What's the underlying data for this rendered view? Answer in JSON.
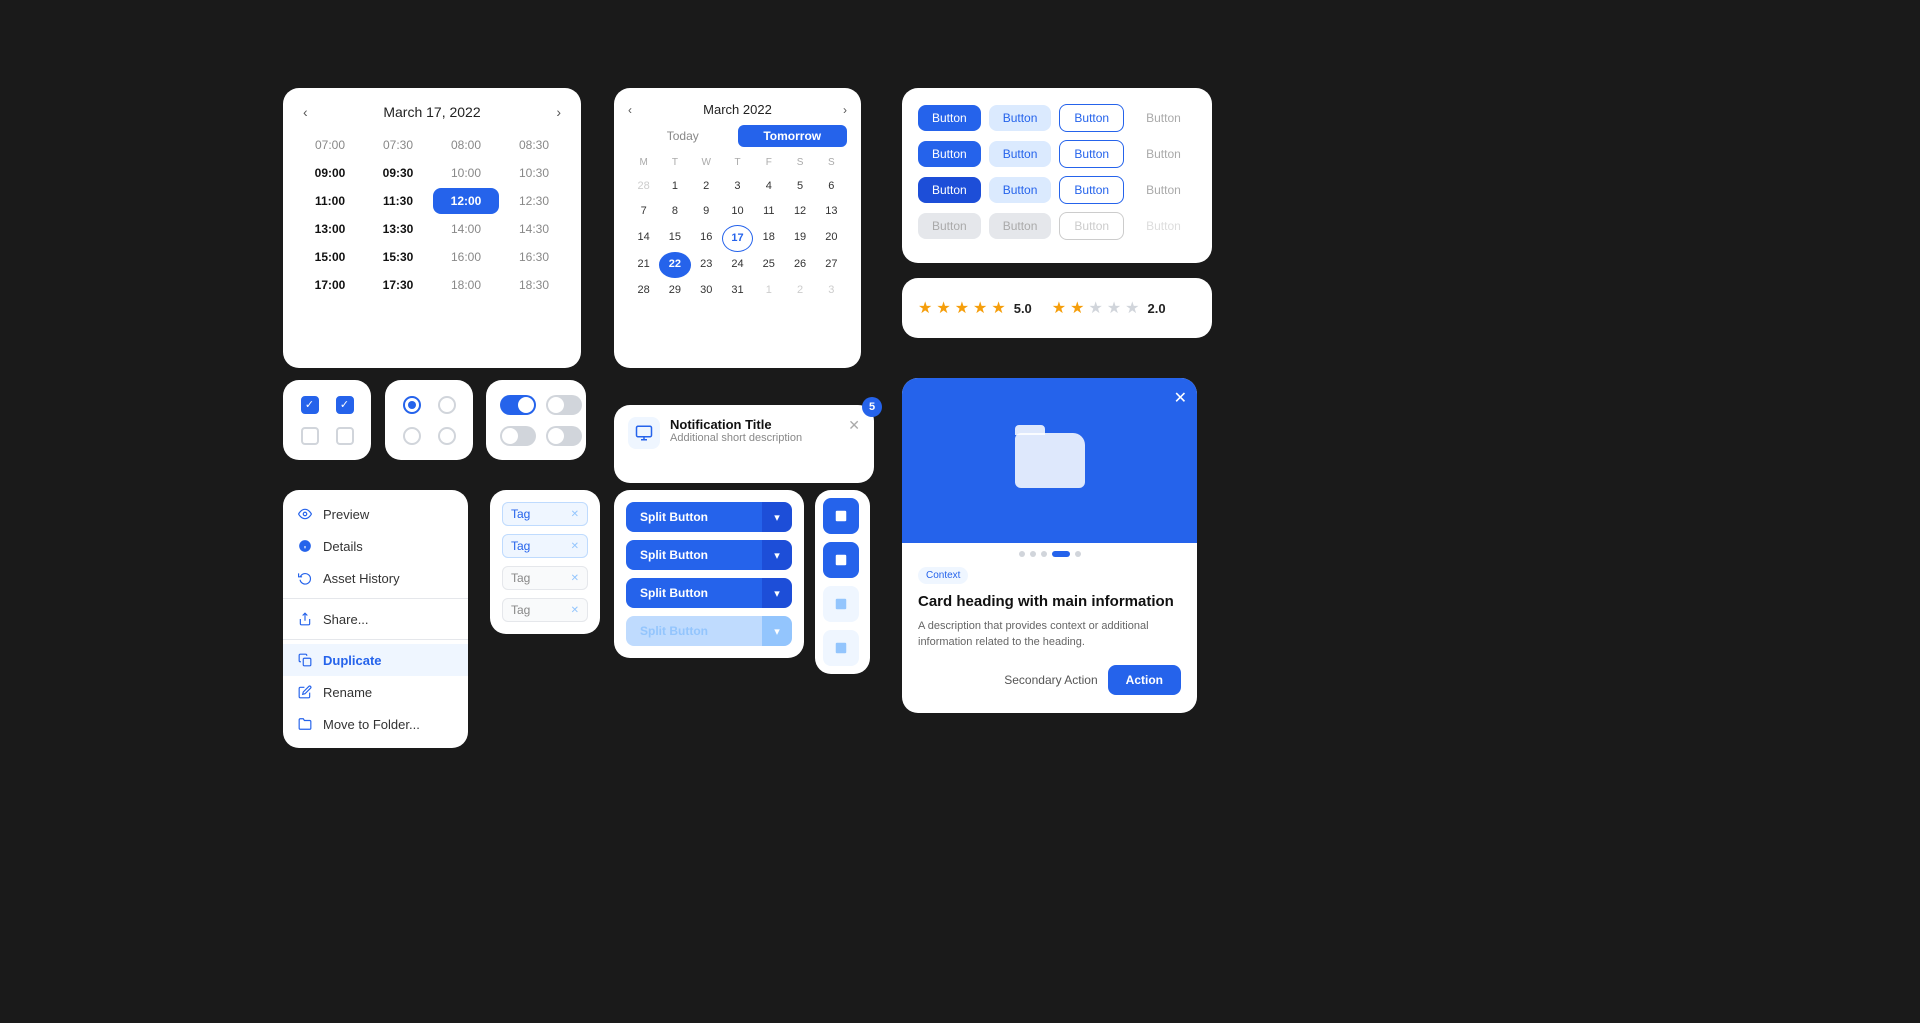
{
  "background": "#1a1a1a",
  "timePicker": {
    "title": "March 17, 2022",
    "rows": [
      [
        "07:00",
        "07:30",
        "08:00",
        "08:30"
      ],
      [
        "09:00",
        "09:30",
        "10:00",
        "10:30"
      ],
      [
        "11:00",
        "11:30",
        "12:00",
        "12:30"
      ],
      [
        "13:00",
        "13:30",
        "14:00",
        "14:30"
      ],
      [
        "15:00",
        "15:30",
        "16:00",
        "16:30"
      ],
      [
        "17:00",
        "17:30",
        "18:00",
        "18:30"
      ]
    ],
    "bold": [
      "09:00",
      "09:30",
      "11:00",
      "11:30",
      "13:00",
      "13:30",
      "15:00",
      "15:30",
      "17:00",
      "17:30"
    ],
    "selected": "12:00"
  },
  "calendar": {
    "title": "March 2022",
    "tabs": [
      "Today",
      "Tomorrow"
    ],
    "activeTab": "Tomorrow",
    "daysOfWeek": [
      "M",
      "T",
      "W",
      "T",
      "F",
      "S",
      "S"
    ],
    "weeks": [
      [
        {
          "n": "28",
          "other": true
        },
        {
          "n": "1"
        },
        {
          "n": "2"
        },
        {
          "n": "3"
        },
        {
          "n": "4"
        },
        {
          "n": "5"
        },
        {
          "n": "6"
        }
      ],
      [
        {
          "n": "7"
        },
        {
          "n": "8"
        },
        {
          "n": "9"
        },
        {
          "n": "10"
        },
        {
          "n": "11"
        },
        {
          "n": "12"
        },
        {
          "n": "13"
        }
      ],
      [
        {
          "n": "14"
        },
        {
          "n": "15"
        },
        {
          "n": "16"
        },
        {
          "n": "17",
          "today": true
        },
        {
          "n": "18"
        },
        {
          "n": "19"
        },
        {
          "n": "20"
        }
      ],
      [
        {
          "n": "21"
        },
        {
          "n": "22",
          "selected": true
        },
        {
          "n": "23"
        },
        {
          "n": "24"
        },
        {
          "n": "25"
        },
        {
          "n": "26"
        },
        {
          "n": "27"
        }
      ],
      [
        {
          "n": "28"
        },
        {
          "n": "29"
        },
        {
          "n": "30"
        },
        {
          "n": "31"
        },
        {
          "n": "1",
          "other": true
        },
        {
          "n": "2",
          "other": true
        },
        {
          "n": "3",
          "other": true
        }
      ]
    ]
  },
  "buttonsGrid": {
    "rows": [
      [
        {
          "label": "Button",
          "type": "primary"
        },
        {
          "label": "Button",
          "type": "primary-light"
        },
        {
          "label": "Button",
          "type": "outline"
        },
        {
          "label": "Button",
          "type": "ghost"
        }
      ],
      [
        {
          "label": "Button",
          "type": "primary"
        },
        {
          "label": "Button",
          "type": "primary-light"
        },
        {
          "label": "Button",
          "type": "outline"
        },
        {
          "label": "Button",
          "type": "ghost"
        }
      ],
      [
        {
          "label": "Button",
          "type": "primary-dark"
        },
        {
          "label": "Button",
          "type": "primary-light"
        },
        {
          "label": "Button",
          "type": "outline"
        },
        {
          "label": "Button",
          "type": "ghost"
        }
      ],
      [
        {
          "label": "Button",
          "type": "disabled"
        },
        {
          "label": "Button",
          "type": "disabled"
        },
        {
          "label": "Button",
          "type": "outline-disabled"
        },
        {
          "label": "Button",
          "type": "ghost-disabled"
        }
      ]
    ]
  },
  "stars": {
    "group1": {
      "value": 5.0,
      "filled": 5,
      "empty": 0
    },
    "group2": {
      "value": 2.0,
      "filled": 2,
      "empty": 3
    }
  },
  "card": {
    "tag": "Context",
    "heading": "Card heading with main information",
    "description": "A description that provides context or additional information related to the heading.",
    "secondaryAction": "Secondary Action",
    "primaryAction": "Action",
    "dots": 5,
    "activeDot": 3
  },
  "checkboxes": [
    {
      "checked": true
    },
    {
      "checked": true
    },
    {
      "checked": false
    },
    {
      "checked": false
    }
  ],
  "radios": [
    {
      "checked": true
    },
    {
      "checked": false
    },
    {
      "checked": false
    },
    {
      "checked": false
    }
  ],
  "toggles": [
    {
      "on": true
    },
    {
      "on": false
    },
    {
      "on": false
    },
    {
      "on": false
    }
  ],
  "contextMenu": {
    "items": [
      {
        "label": "Preview",
        "icon": "👁",
        "active": false
      },
      {
        "label": "Details",
        "icon": "ℹ️",
        "active": false
      },
      {
        "label": "Asset History",
        "icon": "🔄",
        "active": false
      },
      {
        "divider": true
      },
      {
        "label": "Share...",
        "icon": "📤",
        "active": false
      },
      {
        "divider": true
      },
      {
        "label": "Duplicate",
        "icon": "📋",
        "active": true
      },
      {
        "label": "Rename",
        "icon": "✏️",
        "active": false
      },
      {
        "label": "Move to Folder...",
        "icon": "📁",
        "active": false
      }
    ]
  },
  "tags": [
    {
      "label": "Tag",
      "ghost": false
    },
    {
      "label": "Tag",
      "ghost": false
    },
    {
      "label": "Tag",
      "ghost": true
    },
    {
      "label": "Tag",
      "ghost": true
    }
  ],
  "splitButtons": [
    {
      "label": "Split Button",
      "active": true
    },
    {
      "label": "Split Button",
      "active": true
    },
    {
      "label": "Split Button",
      "active": true
    },
    {
      "label": "Split Button",
      "active": false
    }
  ],
  "iconButtons": [
    {
      "icon": "⬛",
      "active": true
    },
    {
      "icon": "⬛",
      "active": true
    },
    {
      "icon": "⬛",
      "active": false
    },
    {
      "icon": "⬛",
      "active": false
    }
  ],
  "notification": {
    "title": "Notification Title",
    "description": "Additional short description",
    "badge": "5"
  }
}
